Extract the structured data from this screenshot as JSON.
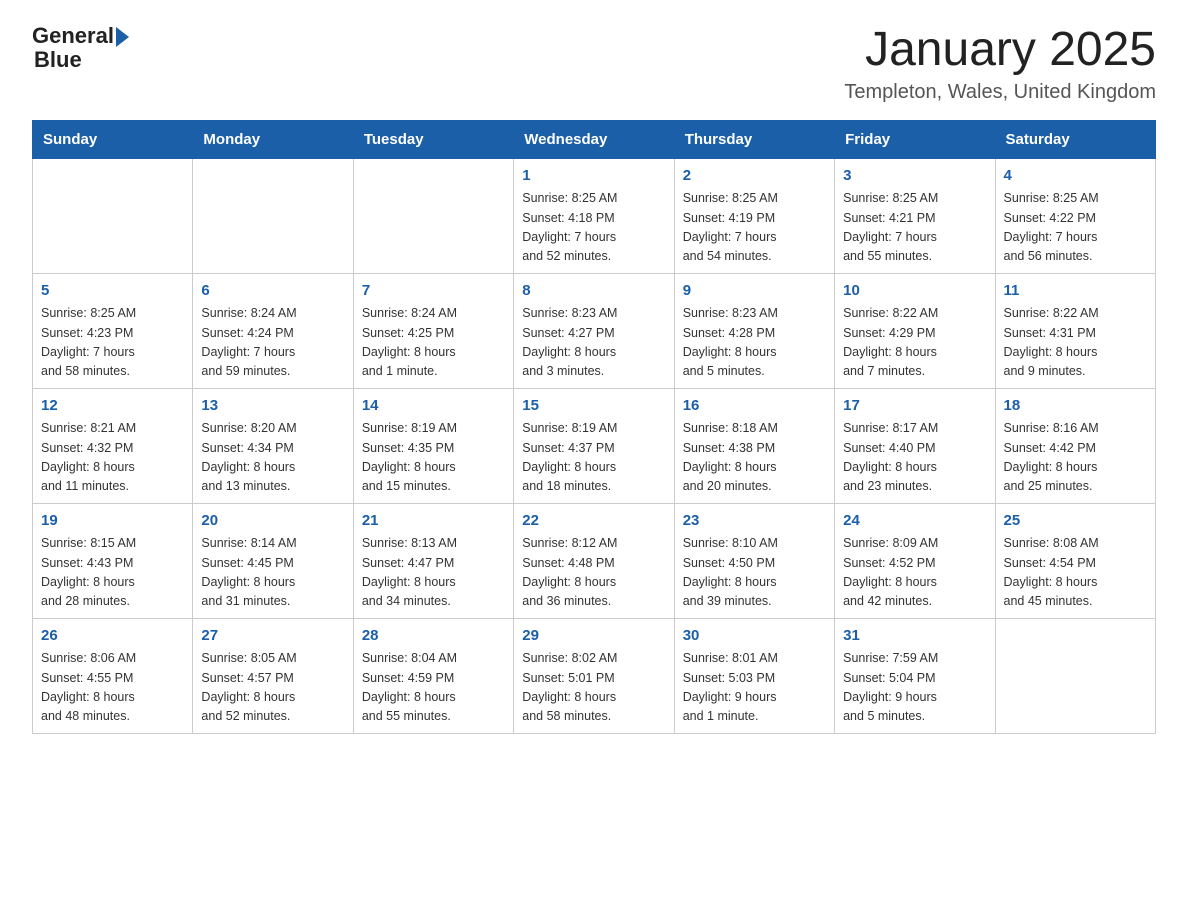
{
  "header": {
    "logo_text_general": "General",
    "logo_text_blue": "Blue",
    "month_title": "January 2025",
    "location": "Templeton, Wales, United Kingdom"
  },
  "days_of_week": [
    "Sunday",
    "Monday",
    "Tuesday",
    "Wednesday",
    "Thursday",
    "Friday",
    "Saturday"
  ],
  "weeks": [
    [
      {
        "day": "",
        "info": ""
      },
      {
        "day": "",
        "info": ""
      },
      {
        "day": "",
        "info": ""
      },
      {
        "day": "1",
        "info": "Sunrise: 8:25 AM\nSunset: 4:18 PM\nDaylight: 7 hours\nand 52 minutes."
      },
      {
        "day": "2",
        "info": "Sunrise: 8:25 AM\nSunset: 4:19 PM\nDaylight: 7 hours\nand 54 minutes."
      },
      {
        "day": "3",
        "info": "Sunrise: 8:25 AM\nSunset: 4:21 PM\nDaylight: 7 hours\nand 55 minutes."
      },
      {
        "day": "4",
        "info": "Sunrise: 8:25 AM\nSunset: 4:22 PM\nDaylight: 7 hours\nand 56 minutes."
      }
    ],
    [
      {
        "day": "5",
        "info": "Sunrise: 8:25 AM\nSunset: 4:23 PM\nDaylight: 7 hours\nand 58 minutes."
      },
      {
        "day": "6",
        "info": "Sunrise: 8:24 AM\nSunset: 4:24 PM\nDaylight: 7 hours\nand 59 minutes."
      },
      {
        "day": "7",
        "info": "Sunrise: 8:24 AM\nSunset: 4:25 PM\nDaylight: 8 hours\nand 1 minute."
      },
      {
        "day": "8",
        "info": "Sunrise: 8:23 AM\nSunset: 4:27 PM\nDaylight: 8 hours\nand 3 minutes."
      },
      {
        "day": "9",
        "info": "Sunrise: 8:23 AM\nSunset: 4:28 PM\nDaylight: 8 hours\nand 5 minutes."
      },
      {
        "day": "10",
        "info": "Sunrise: 8:22 AM\nSunset: 4:29 PM\nDaylight: 8 hours\nand 7 minutes."
      },
      {
        "day": "11",
        "info": "Sunrise: 8:22 AM\nSunset: 4:31 PM\nDaylight: 8 hours\nand 9 minutes."
      }
    ],
    [
      {
        "day": "12",
        "info": "Sunrise: 8:21 AM\nSunset: 4:32 PM\nDaylight: 8 hours\nand 11 minutes."
      },
      {
        "day": "13",
        "info": "Sunrise: 8:20 AM\nSunset: 4:34 PM\nDaylight: 8 hours\nand 13 minutes."
      },
      {
        "day": "14",
        "info": "Sunrise: 8:19 AM\nSunset: 4:35 PM\nDaylight: 8 hours\nand 15 minutes."
      },
      {
        "day": "15",
        "info": "Sunrise: 8:19 AM\nSunset: 4:37 PM\nDaylight: 8 hours\nand 18 minutes."
      },
      {
        "day": "16",
        "info": "Sunrise: 8:18 AM\nSunset: 4:38 PM\nDaylight: 8 hours\nand 20 minutes."
      },
      {
        "day": "17",
        "info": "Sunrise: 8:17 AM\nSunset: 4:40 PM\nDaylight: 8 hours\nand 23 minutes."
      },
      {
        "day": "18",
        "info": "Sunrise: 8:16 AM\nSunset: 4:42 PM\nDaylight: 8 hours\nand 25 minutes."
      }
    ],
    [
      {
        "day": "19",
        "info": "Sunrise: 8:15 AM\nSunset: 4:43 PM\nDaylight: 8 hours\nand 28 minutes."
      },
      {
        "day": "20",
        "info": "Sunrise: 8:14 AM\nSunset: 4:45 PM\nDaylight: 8 hours\nand 31 minutes."
      },
      {
        "day": "21",
        "info": "Sunrise: 8:13 AM\nSunset: 4:47 PM\nDaylight: 8 hours\nand 34 minutes."
      },
      {
        "day": "22",
        "info": "Sunrise: 8:12 AM\nSunset: 4:48 PM\nDaylight: 8 hours\nand 36 minutes."
      },
      {
        "day": "23",
        "info": "Sunrise: 8:10 AM\nSunset: 4:50 PM\nDaylight: 8 hours\nand 39 minutes."
      },
      {
        "day": "24",
        "info": "Sunrise: 8:09 AM\nSunset: 4:52 PM\nDaylight: 8 hours\nand 42 minutes."
      },
      {
        "day": "25",
        "info": "Sunrise: 8:08 AM\nSunset: 4:54 PM\nDaylight: 8 hours\nand 45 minutes."
      }
    ],
    [
      {
        "day": "26",
        "info": "Sunrise: 8:06 AM\nSunset: 4:55 PM\nDaylight: 8 hours\nand 48 minutes."
      },
      {
        "day": "27",
        "info": "Sunrise: 8:05 AM\nSunset: 4:57 PM\nDaylight: 8 hours\nand 52 minutes."
      },
      {
        "day": "28",
        "info": "Sunrise: 8:04 AM\nSunset: 4:59 PM\nDaylight: 8 hours\nand 55 minutes."
      },
      {
        "day": "29",
        "info": "Sunrise: 8:02 AM\nSunset: 5:01 PM\nDaylight: 8 hours\nand 58 minutes."
      },
      {
        "day": "30",
        "info": "Sunrise: 8:01 AM\nSunset: 5:03 PM\nDaylight: 9 hours\nand 1 minute."
      },
      {
        "day": "31",
        "info": "Sunrise: 7:59 AM\nSunset: 5:04 PM\nDaylight: 9 hours\nand 5 minutes."
      },
      {
        "day": "",
        "info": ""
      }
    ]
  ]
}
